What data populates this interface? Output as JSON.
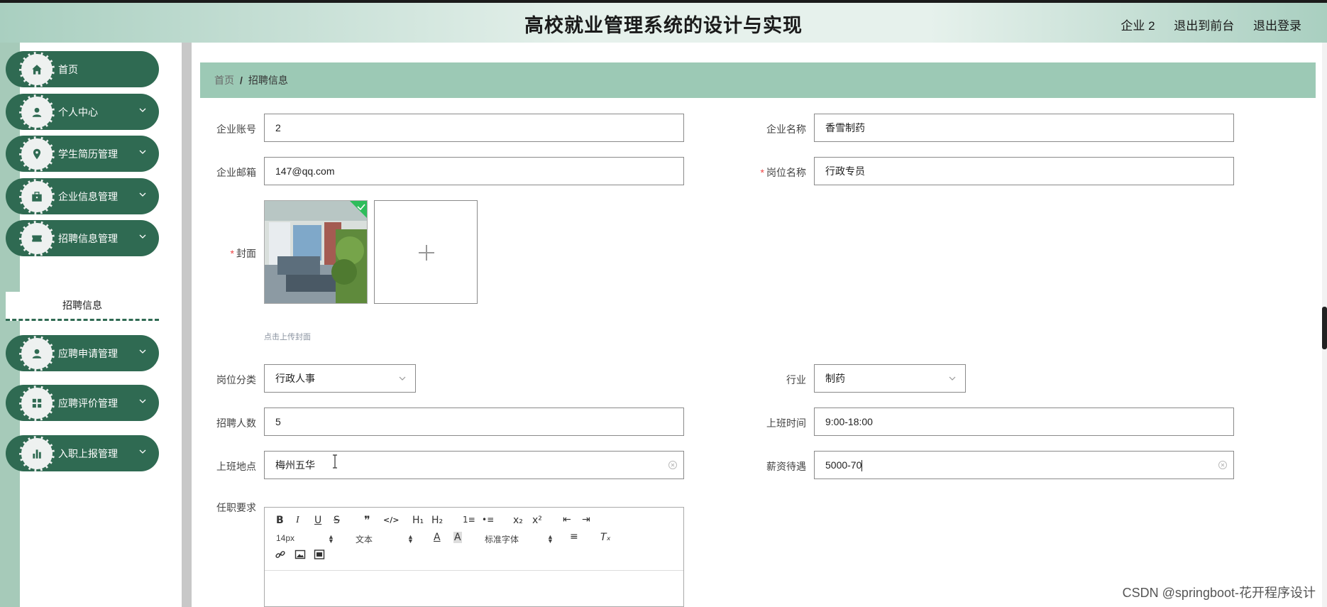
{
  "header": {
    "title": "高校就业管理系统的设计与实现",
    "links": [
      "企业 2",
      "退出到前台",
      "退出登录"
    ]
  },
  "sidebar": {
    "items": [
      {
        "label": "首页",
        "icon": "home-icon",
        "has_arrow": false
      },
      {
        "label": "个人中心",
        "icon": "user-icon",
        "has_arrow": true
      },
      {
        "label": "学生简历管理",
        "icon": "location-icon",
        "has_arrow": true
      },
      {
        "label": "企业信息管理",
        "icon": "briefcase-icon",
        "has_arrow": true
      },
      {
        "label": "招聘信息管理",
        "icon": "ticket-icon",
        "has_arrow": true
      },
      {
        "label": "应聘申请管理",
        "icon": "user-icon",
        "has_arrow": true
      },
      {
        "label": "应聘评价管理",
        "icon": "grid-icon",
        "has_arrow": true
      },
      {
        "label": "入职上报管理",
        "icon": "bar-chart-icon",
        "has_arrow": true
      }
    ],
    "submenu_active": "招聘信息"
  },
  "breadcrumb": {
    "home": "首页",
    "separator": "/",
    "current": "招聘信息"
  },
  "form": {
    "company_account": {
      "label": "企业账号",
      "value": "2"
    },
    "company_name": {
      "label": "企业名称",
      "value": "香雪制药"
    },
    "company_email": {
      "label": "企业邮箱",
      "value": "147@qq.com"
    },
    "position_name": {
      "label": "岗位名称",
      "value": "行政专员",
      "required": true
    },
    "cover": {
      "label": "封面",
      "required": true,
      "tip": "点击上传封面"
    },
    "position_category": {
      "label": "岗位分类",
      "value": "行政人事"
    },
    "industry": {
      "label": "行业",
      "value": "制药"
    },
    "headcount": {
      "label": "招聘人数",
      "value": "5"
    },
    "work_hours": {
      "label": "上班时间",
      "value": "9:00-18:00"
    },
    "work_location": {
      "label": "上班地点",
      "value": "梅州五华"
    },
    "salary": {
      "label": "薪资待遇",
      "value": "5000-70"
    },
    "requirements": {
      "label": "任职要求"
    }
  },
  "editor": {
    "font_size": "14px",
    "block_type": "文本",
    "font_family": "标准字体",
    "buttons": {
      "bold": "B",
      "italic": "I",
      "underline": "U",
      "strike": "S",
      "quote": "❞",
      "code": "</>",
      "h1": "H₁",
      "h2": "H₂",
      "ordered_list": "1≡",
      "bullet_list": "•≡",
      "subscript": "x₂",
      "superscript": "x²",
      "outdent": "⇤",
      "indent": "⇥",
      "font_color": "A",
      "bg_color": "A",
      "align": "≡",
      "clear_format": "Tₓ",
      "link": "🔗",
      "image": "▣",
      "video": "▤"
    }
  },
  "watermark": "CSDN @springboot-花开程序设计",
  "colors": {
    "sidebar_green": "#2f6a52",
    "breadcrumb_green": "#9cc9b5",
    "required_red": "#e44"
  }
}
